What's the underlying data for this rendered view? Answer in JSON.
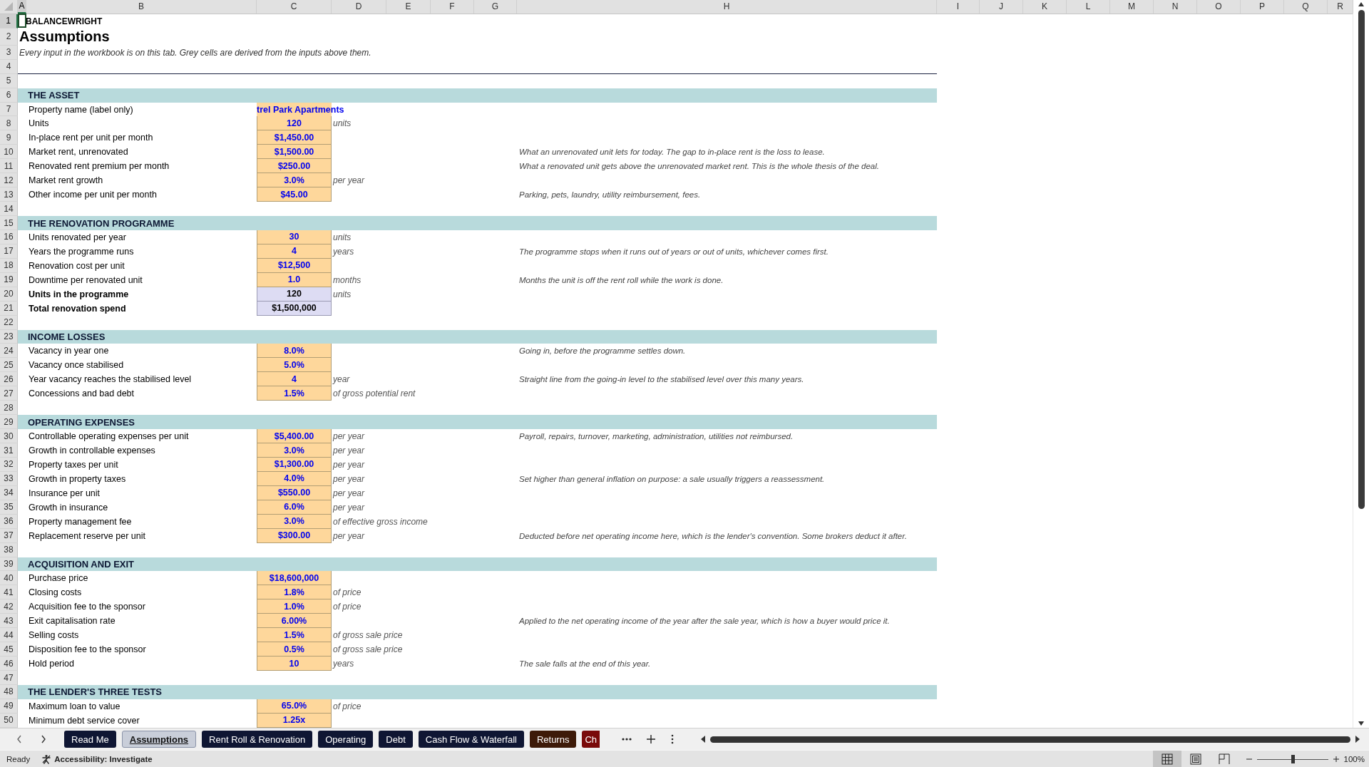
{
  "column_headers": [
    {
      "label": "A",
      "selected": true
    },
    {
      "label": "B",
      "selected": false
    },
    {
      "label": "C",
      "selected": false
    },
    {
      "label": "D",
      "selected": false
    },
    {
      "label": "E",
      "selected": false
    },
    {
      "label": "F",
      "selected": false
    },
    {
      "label": "G",
      "selected": false
    },
    {
      "label": "H",
      "selected": false
    },
    {
      "label": "I",
      "selected": false
    },
    {
      "label": "J",
      "selected": false
    },
    {
      "label": "K",
      "selected": false
    },
    {
      "label": "L",
      "selected": false
    },
    {
      "label": "M",
      "selected": false
    },
    {
      "label": "N",
      "selected": false
    },
    {
      "label": "O",
      "selected": false
    },
    {
      "label": "P",
      "selected": false
    },
    {
      "label": "Q",
      "selected": false
    },
    {
      "label": "R",
      "selected": false
    }
  ],
  "rows": [
    {
      "row": "1",
      "selected": true,
      "kind": "brand",
      "text": "BALANCEWRIGHT"
    },
    {
      "row": "2",
      "selected": false,
      "kind": "title",
      "text": "Assumptions"
    },
    {
      "row": "3",
      "selected": false,
      "kind": "subtitle",
      "text": "Every input in the workbook is on this tab. Grey cells are derived from the inputs above them."
    },
    {
      "row": "4",
      "selected": false,
      "kind": "rule"
    },
    {
      "row": "5",
      "selected": false,
      "kind": "blank"
    },
    {
      "row": "6",
      "selected": false,
      "kind": "section",
      "text": "THE ASSET"
    },
    {
      "row": "7",
      "selected": false,
      "kind": "text-input",
      "label": "Property name (label only)",
      "value": "trel Park Apartments"
    },
    {
      "row": "8",
      "selected": false,
      "kind": "input",
      "label": "Units",
      "value": "120",
      "unit": "units"
    },
    {
      "row": "9",
      "selected": false,
      "kind": "input",
      "label": "In-place rent per unit per month",
      "value": "$1,450.00"
    },
    {
      "row": "10",
      "selected": false,
      "kind": "input",
      "label": "Market rent, unrenovated",
      "value": "$1,500.00",
      "note": "What an unrenovated unit lets for today. The gap to in-place rent is the loss to lease."
    },
    {
      "row": "11",
      "selected": false,
      "kind": "input",
      "label": "Renovated rent premium per month",
      "value": "$250.00",
      "note": "What a renovated unit gets above the unrenovated market rent. This is the whole thesis of the deal."
    },
    {
      "row": "12",
      "selected": false,
      "kind": "input",
      "label": "Market rent growth",
      "value": "3.0%",
      "unit": "per year"
    },
    {
      "row": "13",
      "selected": false,
      "kind": "input",
      "label": "Other income per unit per month",
      "value": "$45.00",
      "note": "Parking, pets, laundry, utility reimbursement, fees."
    },
    {
      "row": "14",
      "selected": false,
      "kind": "blank"
    },
    {
      "row": "15",
      "selected": false,
      "kind": "section",
      "text": "THE RENOVATION PROGRAMME"
    },
    {
      "row": "16",
      "selected": false,
      "kind": "input",
      "label": "Units renovated per year",
      "value": "30",
      "unit": "units"
    },
    {
      "row": "17",
      "selected": false,
      "kind": "input",
      "label": "Years the programme runs",
      "value": "4",
      "unit": "years",
      "note": "The programme stops when it runs out of years or out of units, whichever comes first."
    },
    {
      "row": "18",
      "selected": false,
      "kind": "input",
      "label": "Renovation cost per unit",
      "value": "$12,500"
    },
    {
      "row": "19",
      "selected": false,
      "kind": "input",
      "label": "Downtime per renovated unit",
      "value": "1.0",
      "unit": "months",
      "note": "Months the unit is off the rent roll while the work is done."
    },
    {
      "row": "20",
      "selected": false,
      "kind": "derived",
      "label": "Units in the programme",
      "value": "120",
      "unit": "units"
    },
    {
      "row": "21",
      "selected": false,
      "kind": "derived",
      "label": "Total renovation spend",
      "value": "$1,500,000"
    },
    {
      "row": "22",
      "selected": false,
      "kind": "blank"
    },
    {
      "row": "23",
      "selected": false,
      "kind": "section",
      "text": "INCOME LOSSES"
    },
    {
      "row": "24",
      "selected": false,
      "kind": "input",
      "label": "Vacancy in year one",
      "value": "8.0%",
      "note": "Going in, before the programme settles down."
    },
    {
      "row": "25",
      "selected": false,
      "kind": "input",
      "label": "Vacancy once stabilised",
      "value": "5.0%"
    },
    {
      "row": "26",
      "selected": false,
      "kind": "input",
      "label": "Year vacancy reaches the stabilised level",
      "value": "4",
      "unit": "year",
      "note": "Straight line from the going-in level to the stabilised level over this many years."
    },
    {
      "row": "27",
      "selected": false,
      "kind": "input",
      "label": "Concessions and bad debt",
      "value": "1.5%",
      "unit": "of gross potential rent"
    },
    {
      "row": "28",
      "selected": false,
      "kind": "blank"
    },
    {
      "row": "29",
      "selected": false,
      "kind": "section",
      "text": "OPERATING EXPENSES"
    },
    {
      "row": "30",
      "selected": false,
      "kind": "input",
      "label": "Controllable operating expenses per unit",
      "value": "$5,400.00",
      "unit": "per year",
      "note": "Payroll, repairs, turnover, marketing, administration, utilities not reimbursed."
    },
    {
      "row": "31",
      "selected": false,
      "kind": "input",
      "label": "Growth in controllable expenses",
      "value": "3.0%",
      "unit": "per year"
    },
    {
      "row": "32",
      "selected": false,
      "kind": "input",
      "label": "Property taxes per unit",
      "value": "$1,300.00",
      "unit": "per year"
    },
    {
      "row": "33",
      "selected": false,
      "kind": "input",
      "label": "Growth in property taxes",
      "value": "4.0%",
      "unit": "per year",
      "note": "Set higher than general inflation on purpose: a sale usually triggers a reassessment."
    },
    {
      "row": "34",
      "selected": false,
      "kind": "input",
      "label": "Insurance per unit",
      "value": "$550.00",
      "unit": "per year"
    },
    {
      "row": "35",
      "selected": false,
      "kind": "input",
      "label": "Growth in insurance",
      "value": "6.0%",
      "unit": "per year"
    },
    {
      "row": "36",
      "selected": false,
      "kind": "input",
      "label": "Property management fee",
      "value": "3.0%",
      "unit": "of effective gross income"
    },
    {
      "row": "37",
      "selected": false,
      "kind": "input",
      "label": "Replacement reserve per unit",
      "value": "$300.00",
      "unit": "per year",
      "note": "Deducted before net operating income here, which is the lender's convention. Some brokers deduct it after."
    },
    {
      "row": "38",
      "selected": false,
      "kind": "blank"
    },
    {
      "row": "39",
      "selected": false,
      "kind": "section",
      "text": "ACQUISITION AND EXIT"
    },
    {
      "row": "40",
      "selected": false,
      "kind": "input",
      "label": "Purchase price",
      "value": "$18,600,000"
    },
    {
      "row": "41",
      "selected": false,
      "kind": "input",
      "label": "Closing costs",
      "value": "1.8%",
      "unit": "of price"
    },
    {
      "row": "42",
      "selected": false,
      "kind": "input",
      "label": "Acquisition fee to the sponsor",
      "value": "1.0%",
      "unit": "of price"
    },
    {
      "row": "43",
      "selected": false,
      "kind": "input",
      "label": "Exit capitalisation rate",
      "value": "6.00%",
      "note": "Applied to the net operating income of the year after the sale year, which is how a buyer would price it."
    },
    {
      "row": "44",
      "selected": false,
      "kind": "input",
      "label": "Selling costs",
      "value": "1.5%",
      "unit": "of gross sale price"
    },
    {
      "row": "45",
      "selected": false,
      "kind": "input",
      "label": "Disposition fee to the sponsor",
      "value": "0.5%",
      "unit": "of gross sale price"
    },
    {
      "row": "46",
      "selected": false,
      "kind": "input",
      "label": "Hold period",
      "value": "10",
      "unit": "years",
      "note": "The sale falls at the end of this year."
    },
    {
      "row": "47",
      "selected": false,
      "kind": "blank"
    },
    {
      "row": "48",
      "selected": false,
      "kind": "section",
      "text": "THE LENDER'S THREE TESTS"
    },
    {
      "row": "49",
      "selected": false,
      "kind": "input",
      "label": "Maximum loan to value",
      "value": "65.0%",
      "unit": "of price"
    },
    {
      "row": "50",
      "selected": false,
      "kind": "input",
      "label": "Minimum debt service cover",
      "value": "1.25x"
    }
  ],
  "tabs": [
    {
      "label": "Read Me",
      "selected": false,
      "color": "#0f1633"
    },
    {
      "label": "Assumptions",
      "selected": true,
      "color": "#c9ced9"
    },
    {
      "label": "Rent Roll & Renovation",
      "selected": false,
      "color": "#0f1633"
    },
    {
      "label": "Operating",
      "selected": false,
      "color": "#0f1633"
    },
    {
      "label": "Debt",
      "selected": false,
      "color": "#0f1633"
    },
    {
      "label": "Cash Flow & Waterfall",
      "selected": false,
      "color": "#0f1633"
    },
    {
      "label": "Returns",
      "selected": false,
      "color": "#3d1a08"
    },
    {
      "label": "Ch",
      "selected": false,
      "color": "#7a0a0a"
    }
  ],
  "status_bar": {
    "mode": "Ready",
    "accessibility": "Accessibility: Investigate",
    "view_modes": [
      {
        "selected": true
      },
      {
        "selected": false
      },
      {
        "selected": false
      }
    ],
    "zoom": {
      "level": 0.5
    },
    "zoom_text": "100%"
  }
}
